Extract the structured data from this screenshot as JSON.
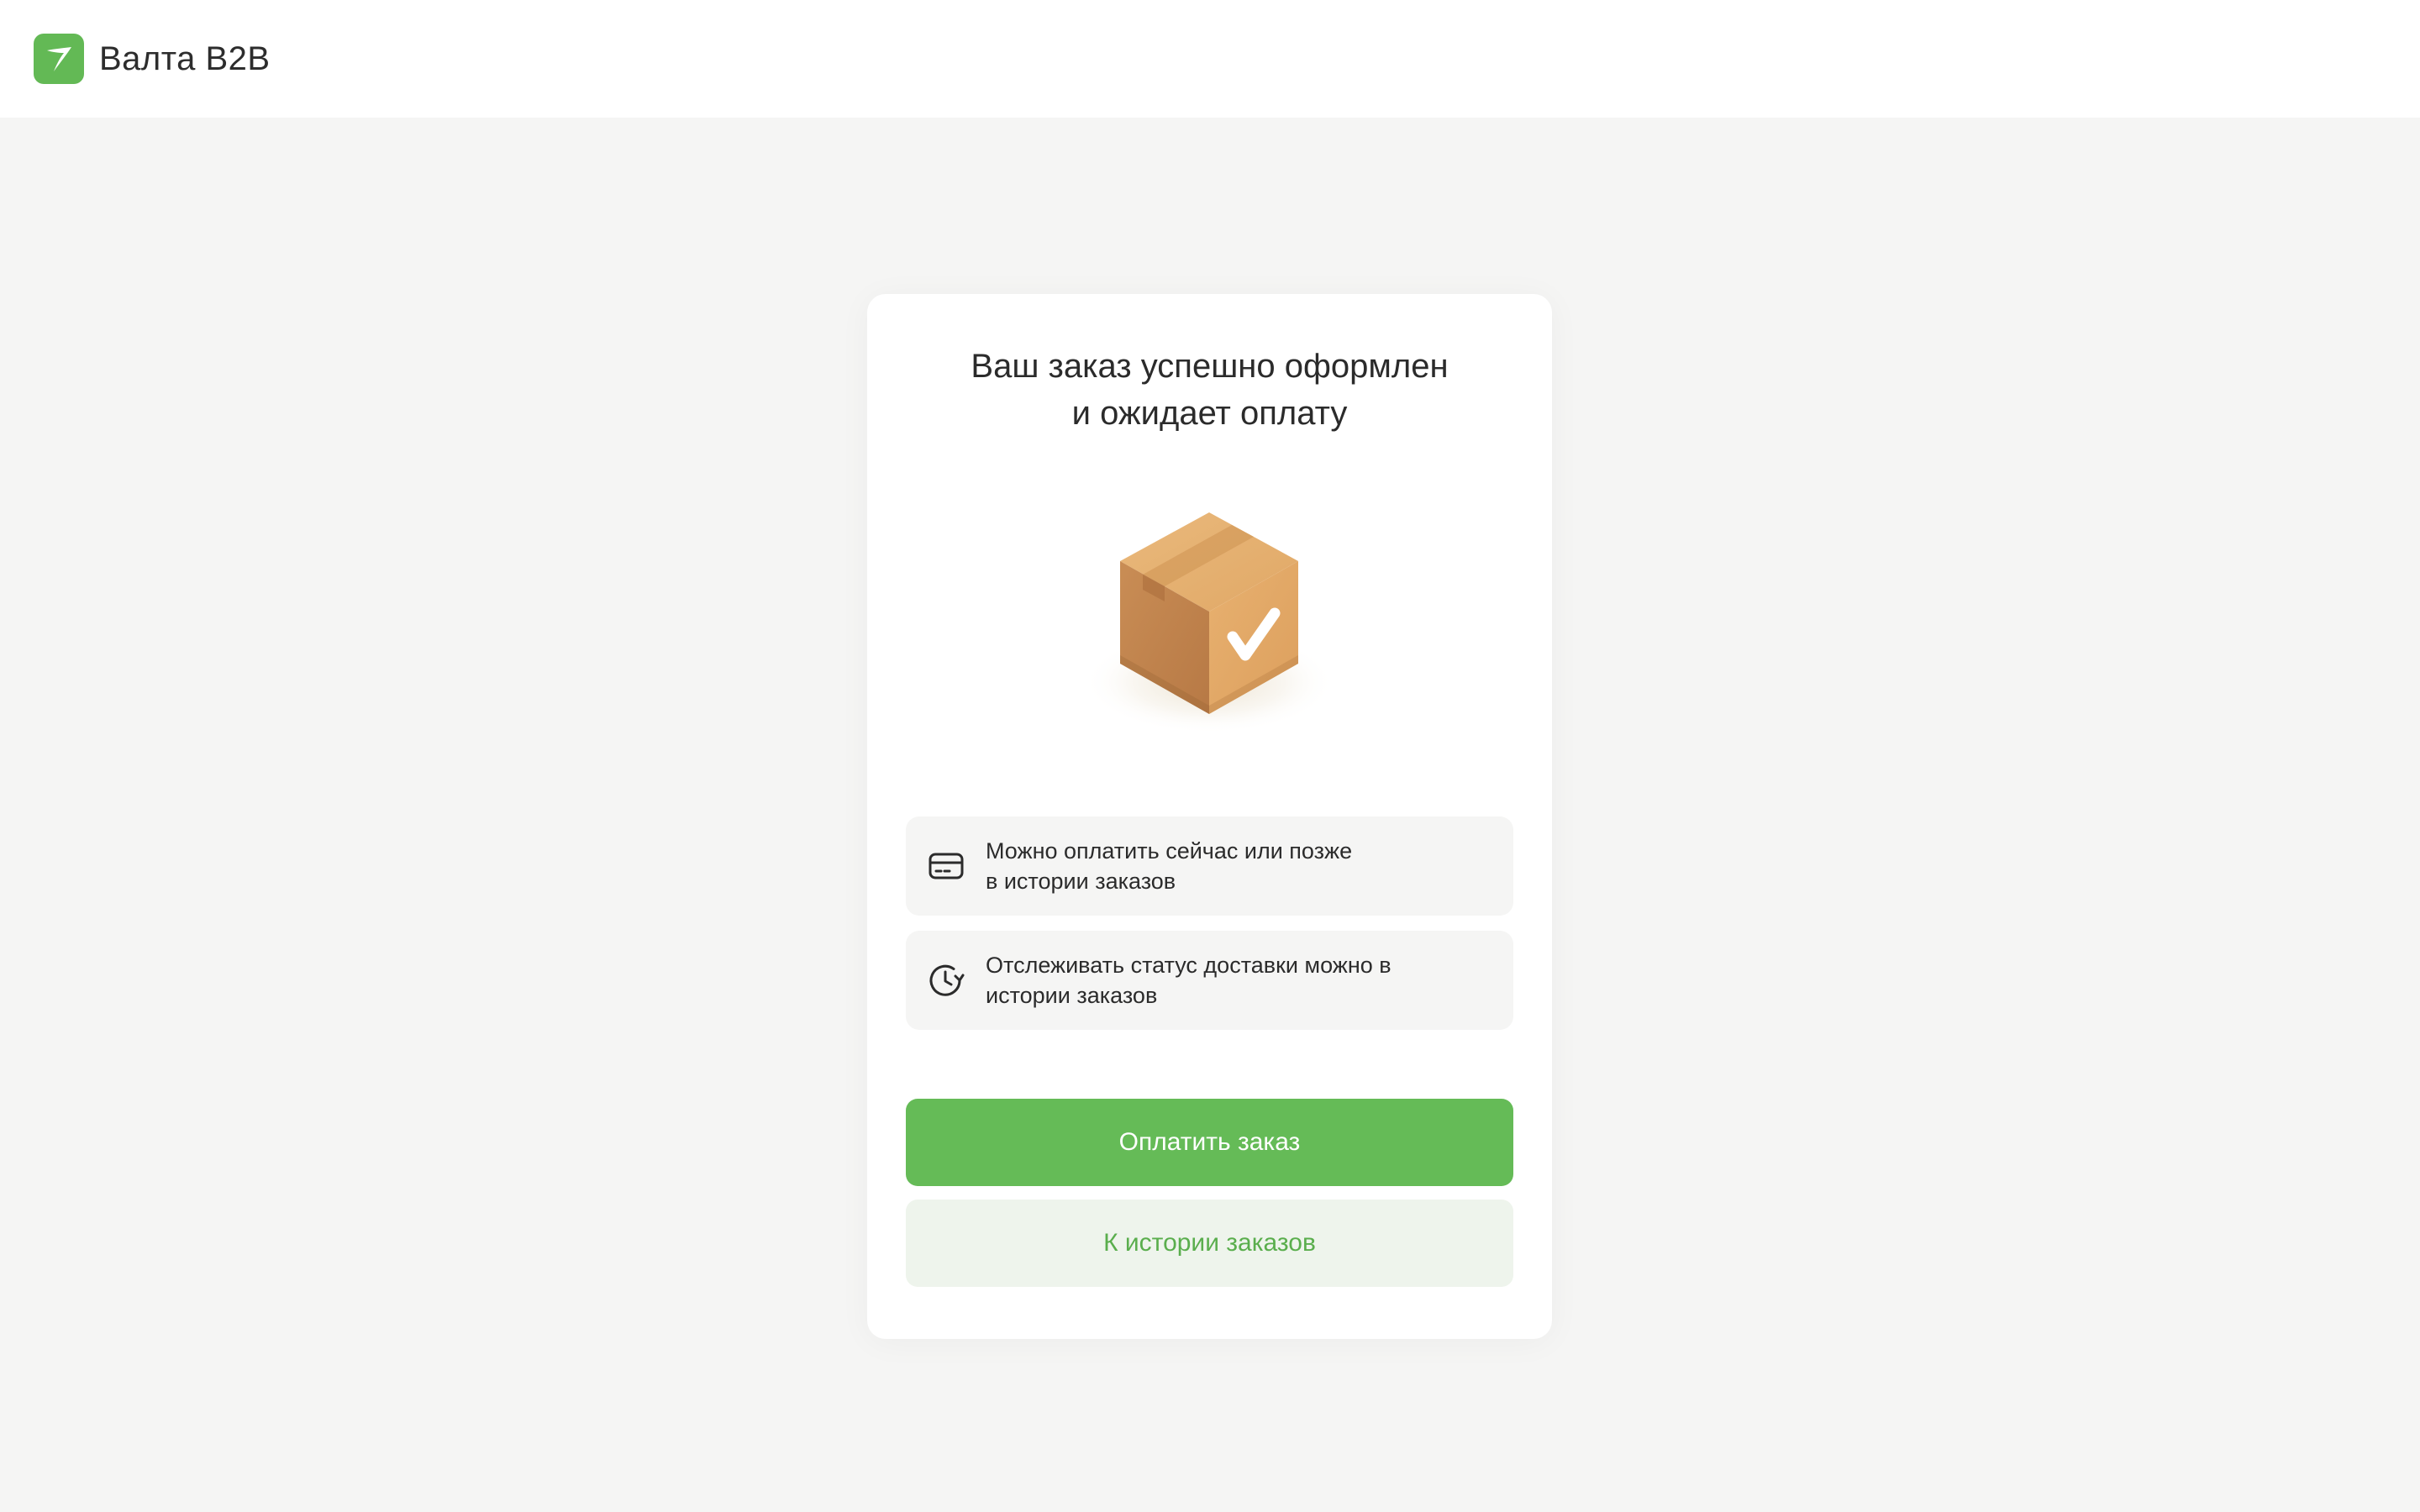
{
  "app": {
    "brand": "Валта B2B",
    "logo_icon": "valta-logo-icon",
    "accent_color": "#65bb57"
  },
  "success": {
    "title_line1": "Ваш заказ успешно оформлен",
    "title_line2": "и ожидает оплату",
    "illustration": "package-check-icon"
  },
  "info_items": [
    {
      "icon": "credit-card-icon",
      "line1": "Можно оплатить сейчас или позже",
      "line2": "в истории заказов"
    },
    {
      "icon": "clock-refresh-icon",
      "line1": "Отслеживать статус доставки можно в",
      "line2": "истории заказов"
    }
  ],
  "actions": {
    "pay_label": "Оплатить заказ",
    "history_label": "К истории заказов"
  }
}
